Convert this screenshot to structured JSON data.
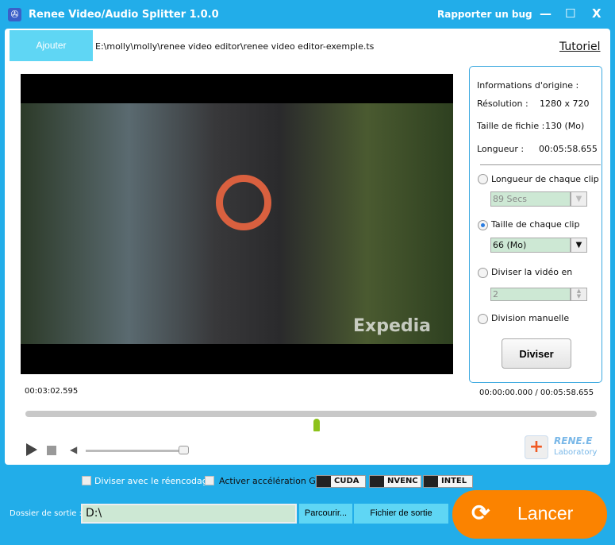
{
  "window": {
    "title": "Renee Video/Audio Splitter 1.0.0",
    "report_bug": "Rapporter un bug",
    "minimize": "—",
    "maximize": "☐",
    "close": "X"
  },
  "toolbar": {
    "add_label": "Ajouter",
    "file_path": "E:\\molly\\molly\\renee video editor\\renee video editor-exemple.ts",
    "tutorial": "Tutoriel"
  },
  "player": {
    "current_time": "00:03:02.595",
    "position_display": "00:00:00.000 / 00:05:58.655",
    "progress": 0.51,
    "volume": 0.95,
    "watermark": "Expedia"
  },
  "info": {
    "heading": "Informations d'origine :",
    "resolution_label": "Résolution :",
    "resolution": "1280 x 720",
    "size_label": "Taille de fichie :",
    "size": "130 (Mo)",
    "length_label": "Longueur :",
    "length": "00:05:58.655"
  },
  "split_options": {
    "clip_length_label": "Longueur de chaque clip",
    "clip_length_value": "89 Secs",
    "clip_size_label": "Taille de chaque clip",
    "clip_size_value": "66 (Mo)",
    "divide_label": "Diviser la vidéo en",
    "divide_value": "2",
    "manual_label": "Division manuelle",
    "selected": "clip_size",
    "split_button": "Diviser"
  },
  "logo": {
    "brand": "RENE.E",
    "sub": "Laboratory"
  },
  "bottom": {
    "reencode_label": "Diviser avec le réencodage",
    "gpu_label": "Activer accélération GPU",
    "gpu_options": [
      "CUDA",
      "NVENC",
      "INTEL"
    ],
    "output_label": "Dossier de sortie :",
    "output_value": "D:\\",
    "browse": "Parcourir...",
    "output_file": "Fichier de sortie",
    "launch": "Lancer"
  },
  "colors": {
    "accent": "#22ade9",
    "launch": "#fb8300",
    "field": "#cde8d4"
  }
}
